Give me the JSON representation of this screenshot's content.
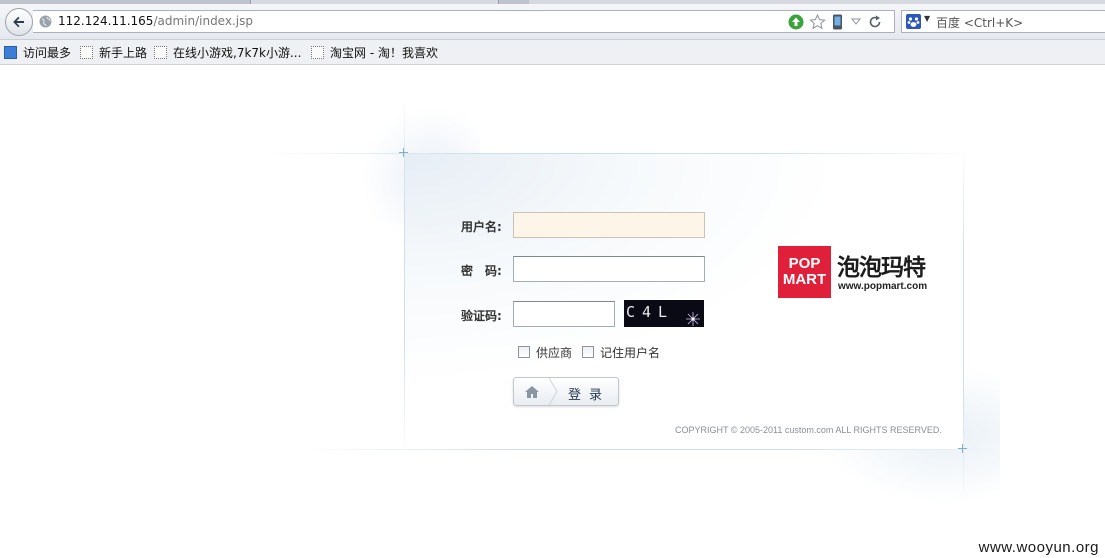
{
  "browser": {
    "url_host": "112.124.11.165",
    "url_path": "/admin/index.jsp",
    "search_engine": "百度",
    "search_placeholder": "<Ctrl+K>",
    "bookmarks": [
      {
        "label": "访问最多",
        "icon": "most-visited-icon"
      },
      {
        "label": "新手上路",
        "icon": "page-icon"
      },
      {
        "label": "在线小游戏,7k7k小游...",
        "icon": "page-icon"
      },
      {
        "label": "淘宝网 - 淘！我喜欢",
        "icon": "page-icon"
      }
    ]
  },
  "login": {
    "username_label": "用户名:",
    "password_label": "密　码:",
    "captcha_label": "验证码:",
    "username_value": "",
    "password_value": "",
    "captcha_value": "",
    "captcha_image_text": "C4L",
    "supplier_label": "供应商",
    "remember_label": "记住用户名",
    "login_button": "登录"
  },
  "brand": {
    "logo_line1": "POP",
    "logo_line2": "MART",
    "name_cn": "泡泡玛特",
    "website": "www.popmart.com"
  },
  "copyright": "COPYRIGHT © 2005-2011 custom.com ALL RIGHTS RESERVED.",
  "watermark": "www.wooyun.org",
  "colors": {
    "brand_red": "#e0203a",
    "username_field_bg": "#fdf5e8"
  }
}
